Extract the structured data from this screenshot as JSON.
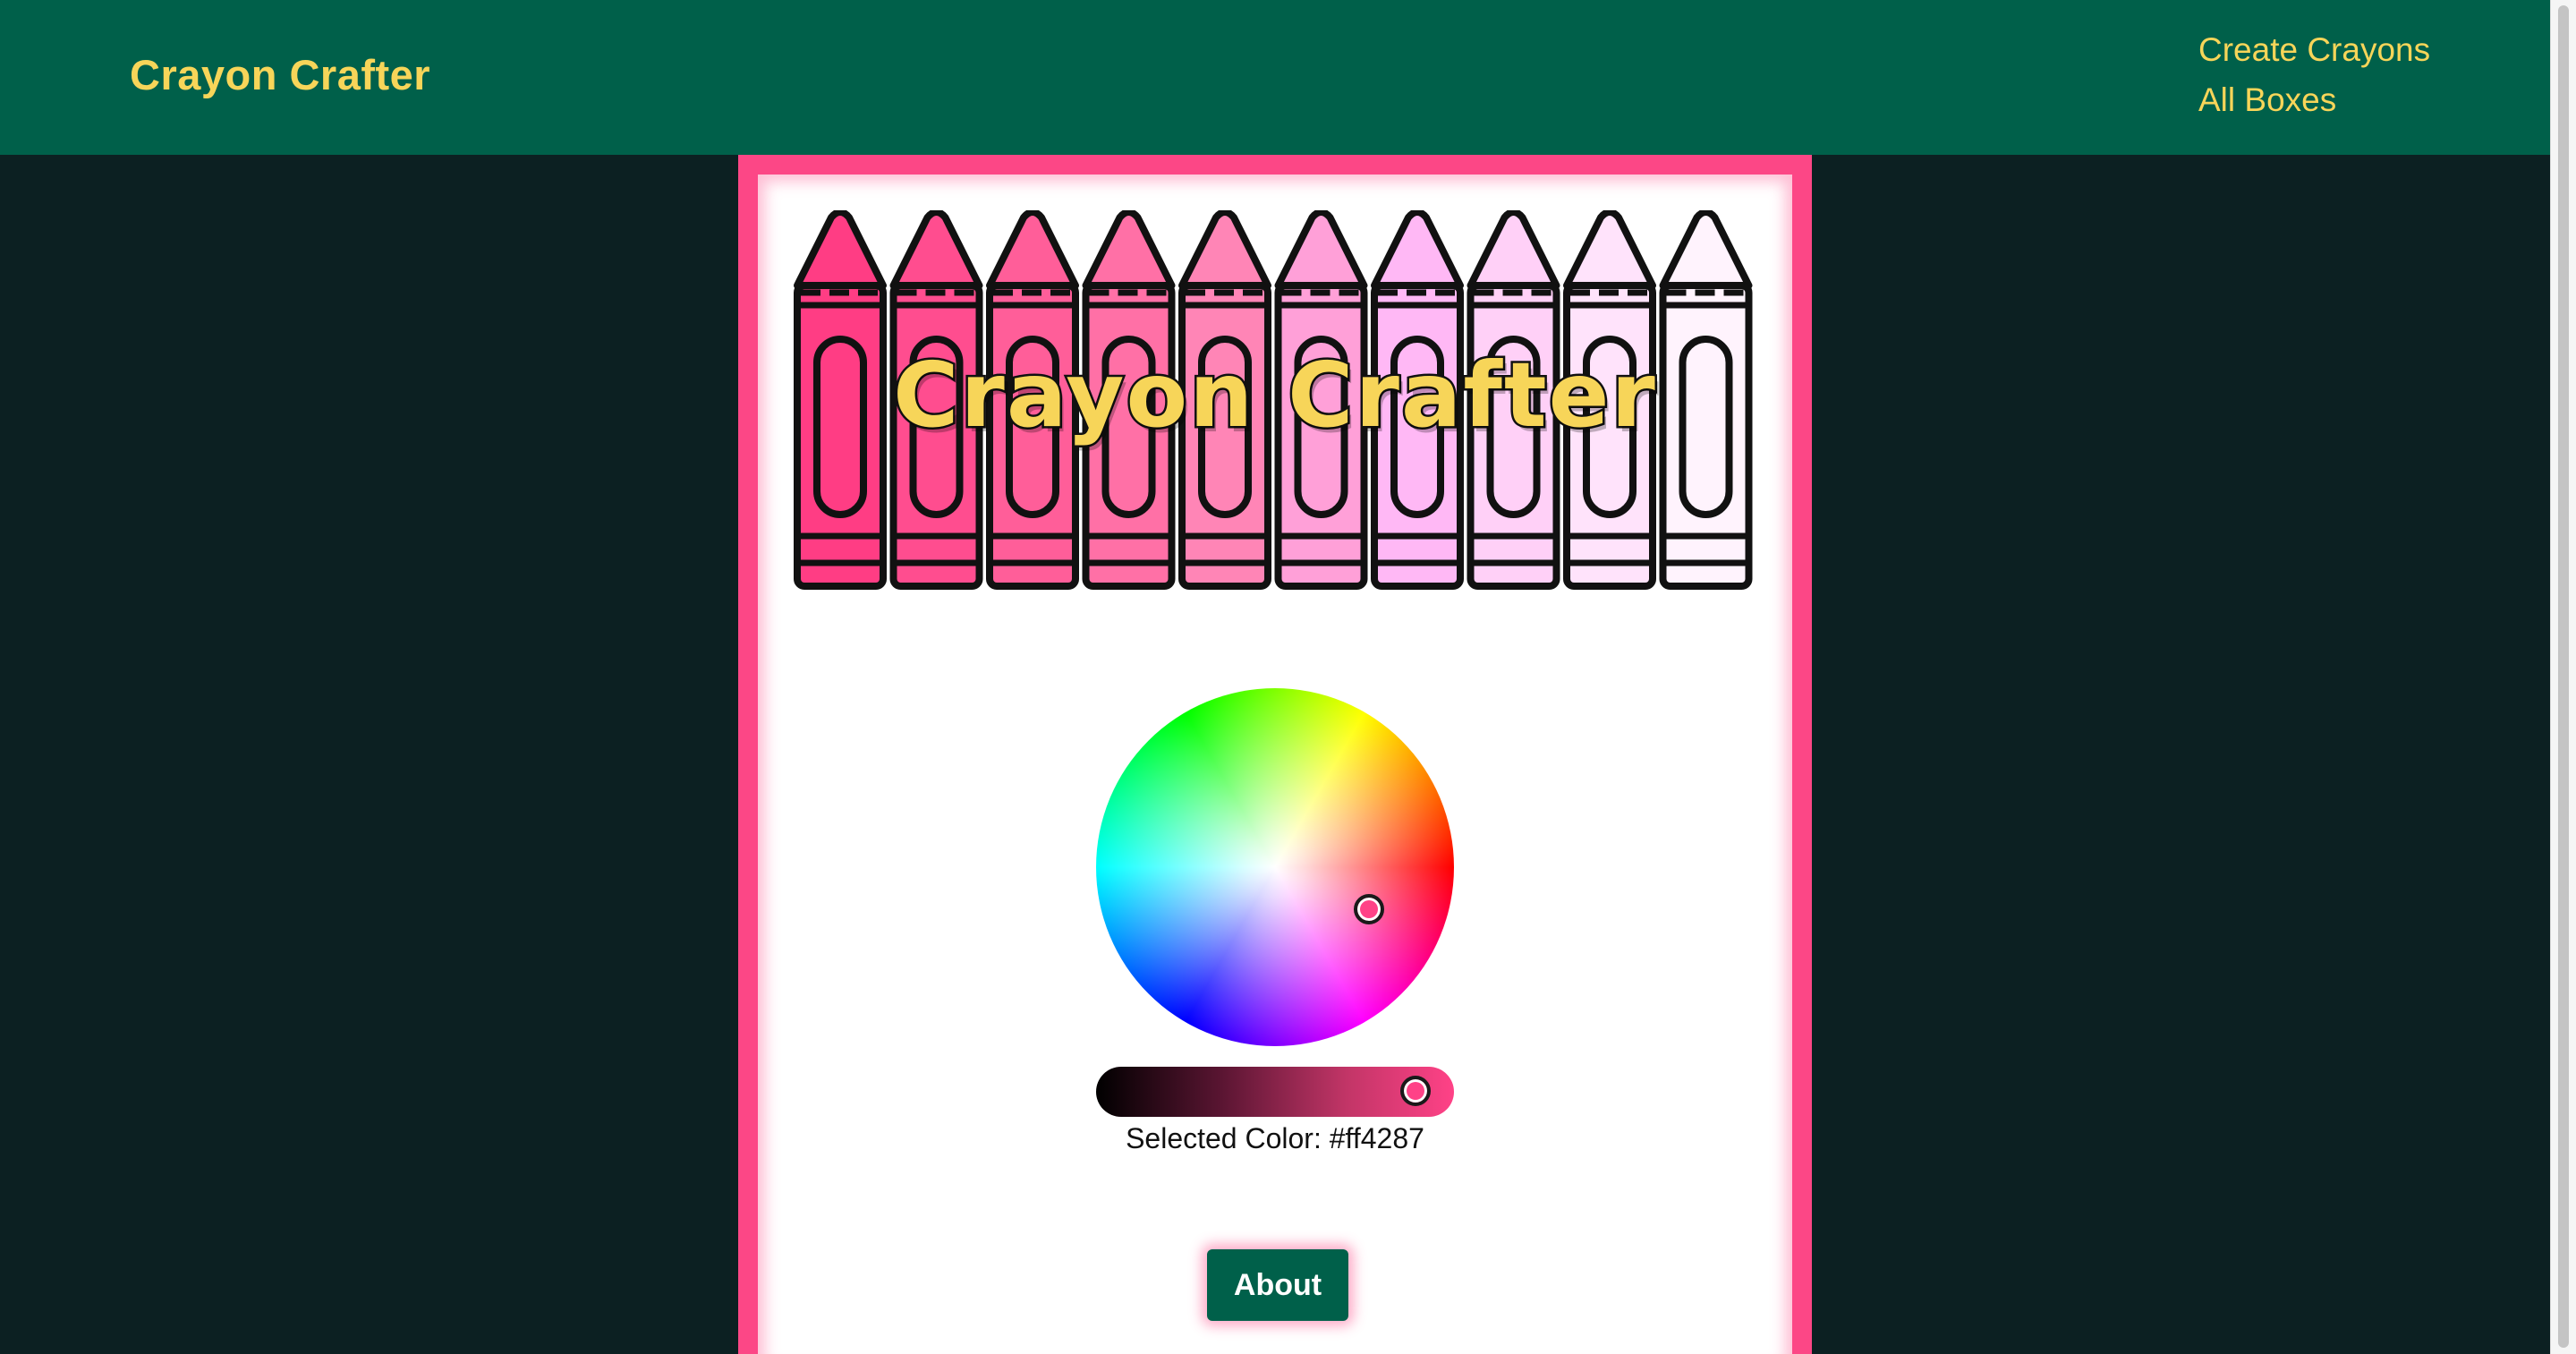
{
  "navbar": {
    "brand": "Crayon Crafter",
    "links": [
      "Create Crayons",
      "All Boxes"
    ],
    "background": "#00604a",
    "accent": "#f7d559"
  },
  "banner": {
    "title": "Crayon Crafter",
    "crayon_colors": [
      "#ff3d84",
      "#ff4d8f",
      "#ff5e99",
      "#ff70a6",
      "#ff85b6",
      "#ffa0d8",
      "#ffb8f5",
      "#ffd0f7",
      "#ffe3fb",
      "#fff3fd"
    ]
  },
  "color_picker": {
    "selected_label": "Selected Color: #ff4287",
    "selected_hex": "#ff4287"
  },
  "actions": {
    "about_label": "About"
  },
  "colors": {
    "page_background": "#0c2022",
    "card_border": "#fc4786",
    "card_background": "#ffffff"
  }
}
